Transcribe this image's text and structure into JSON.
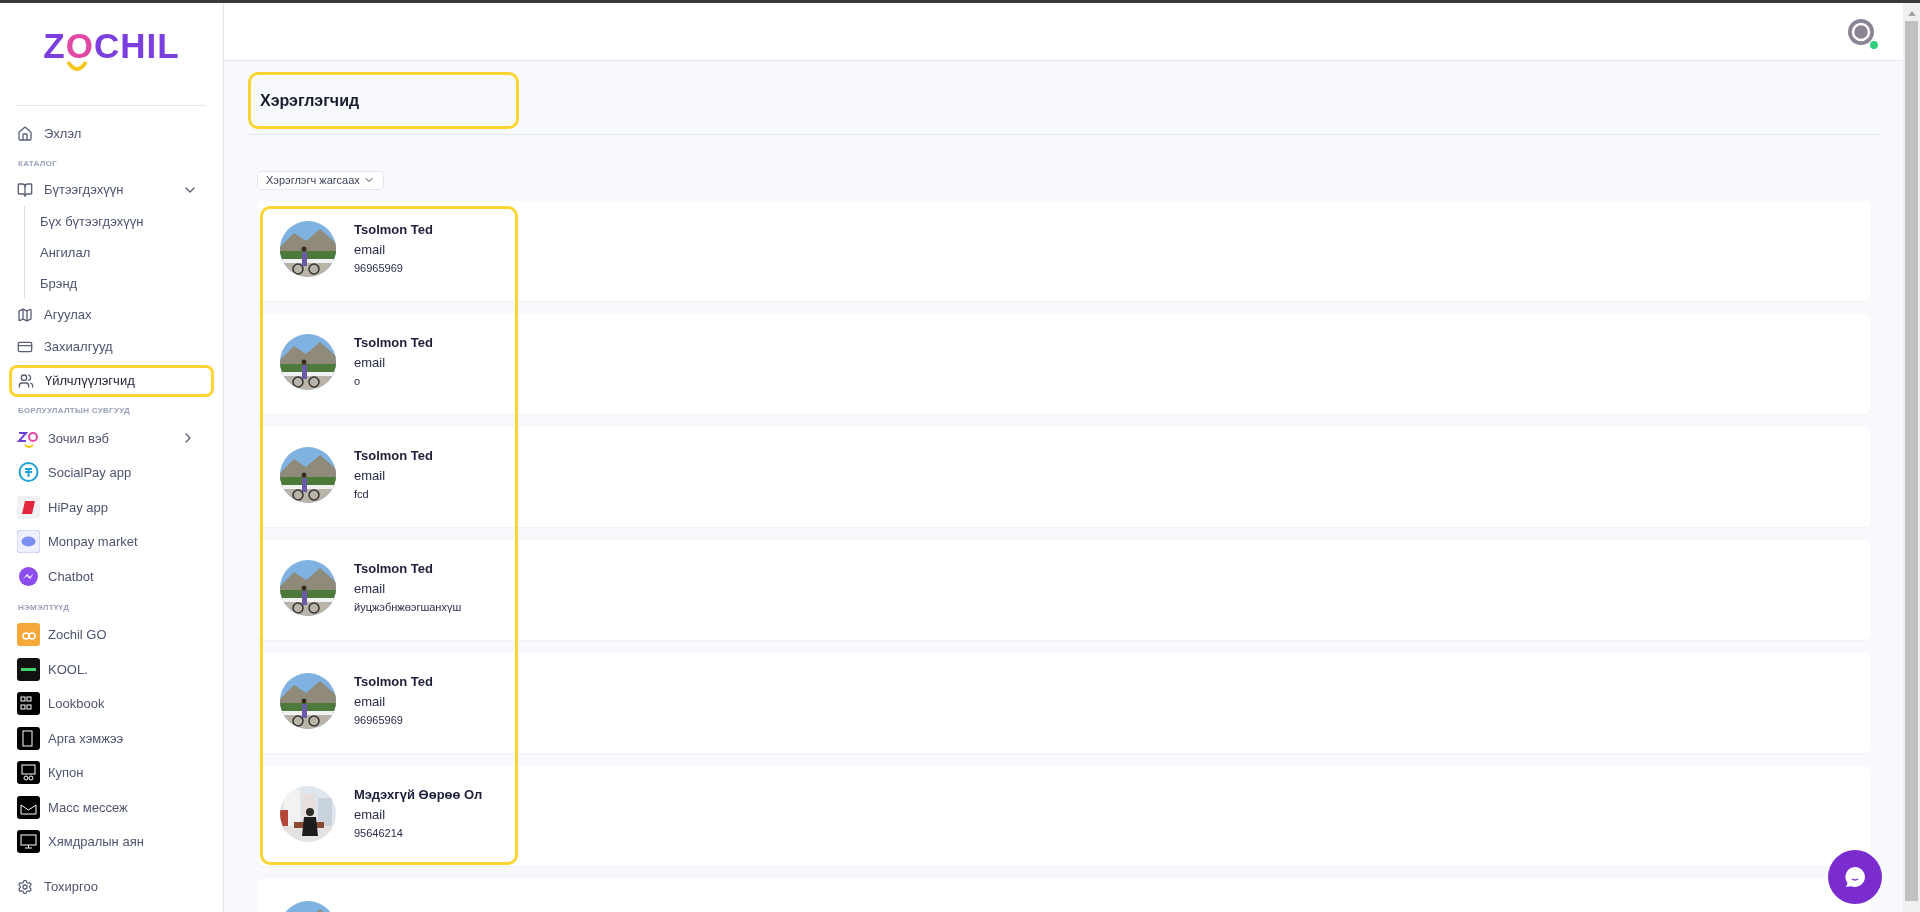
{
  "brand": {
    "logo_text": "ZOCHIL"
  },
  "sidebar": [
    {
      "kind": "item",
      "label": "Эхлэл",
      "selected": false
    },
    {
      "kind": "section",
      "label": "КАТАЛОГ"
    },
    {
      "kind": "item",
      "label": "Бүтээгдэхүүн",
      "selected": false,
      "expanded": true,
      "children": [
        {
          "label": "Бүх бүтээгдэхүүн"
        },
        {
          "label": "Ангилал"
        },
        {
          "label": "Брэнд"
        }
      ]
    },
    {
      "kind": "item",
      "label": "Агуулах",
      "selected": false
    },
    {
      "kind": "item",
      "label": "Захиалгууд",
      "selected": false
    },
    {
      "kind": "item",
      "label": "Үйлчлүүлэгчид",
      "selected": true
    },
    {
      "kind": "section",
      "label": "БОРЛУУЛАЛТЫН СУВГУУД"
    },
    {
      "kind": "app",
      "label": "Зочил вэб",
      "expanded": false
    },
    {
      "kind": "app",
      "label": "SocialPay app"
    },
    {
      "kind": "app",
      "label": "HiPay app"
    },
    {
      "kind": "app",
      "label": "Monpay market"
    },
    {
      "kind": "app",
      "label": "Chatbot"
    },
    {
      "kind": "section",
      "label": "НЭМЭЛТҮҮД"
    },
    {
      "kind": "app",
      "label": "Zochil GO"
    },
    {
      "kind": "app",
      "label": "KOOL."
    },
    {
      "kind": "app",
      "label": "Lookbook"
    },
    {
      "kind": "app",
      "label": "Арга хэмжээ"
    },
    {
      "kind": "app",
      "label": "Купон"
    },
    {
      "kind": "app",
      "label": "Масс мессеж"
    },
    {
      "kind": "app",
      "label": "Хямдралын аян"
    },
    {
      "kind": "item",
      "label": "Тохиргоо",
      "selected": false
    }
  ],
  "header": {
    "user": {
      "online": true
    }
  },
  "page": {
    "title": "Хэрэглэгчид",
    "title_highlighted": true,
    "sort_button": "Хэрэглэгч жагсаах"
  },
  "users": {
    "highlighted": true,
    "rows": [
      {
        "name": "Tsolmon Ted",
        "email": "email",
        "phone": "96965969"
      },
      {
        "name": "Tsolmon Ted",
        "email": "email",
        "phone": "о"
      },
      {
        "name": "Tsolmon Ted",
        "email": "email",
        "phone": "fcd"
      },
      {
        "name": "Tsolmon Ted",
        "email": "email",
        "phone": "йуцжэбнжөэгшанхүш"
      },
      {
        "name": "Tsolmon Ted",
        "email": "email",
        "phone": "96965969"
      },
      {
        "name": "Мэдэхгүй Өөрөө Ол",
        "email": "email",
        "phone": "95646214"
      },
      {
        "kind": "picture"
      }
    ]
  }
}
